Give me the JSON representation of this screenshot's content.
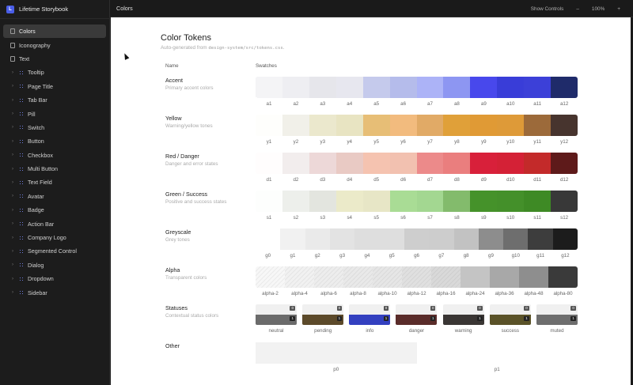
{
  "app": {
    "title": "Lifetime Storybook",
    "logo_letter": "L"
  },
  "sidebar": {
    "items": [
      {
        "label": "Colors",
        "kind": "doc",
        "active": true,
        "expandable": false
      },
      {
        "label": "Iconography",
        "kind": "doc",
        "active": false,
        "expandable": false
      },
      {
        "label": "Text",
        "kind": "doc",
        "active": false,
        "expandable": false
      },
      {
        "label": "Tooltip",
        "kind": "component",
        "active": false,
        "expandable": true
      },
      {
        "label": "Page Title",
        "kind": "component",
        "active": false,
        "expandable": true
      },
      {
        "label": "Tab Bar",
        "kind": "component",
        "active": false,
        "expandable": true
      },
      {
        "label": "Pill",
        "kind": "component",
        "active": false,
        "expandable": true
      },
      {
        "label": "Switch",
        "kind": "component",
        "active": false,
        "expandable": true
      },
      {
        "label": "Button",
        "kind": "component",
        "active": false,
        "expandable": true
      },
      {
        "label": "Checkbox",
        "kind": "component",
        "active": false,
        "expandable": true
      },
      {
        "label": "Multi Button",
        "kind": "component",
        "active": false,
        "expandable": true
      },
      {
        "label": "Text Field",
        "kind": "component",
        "active": false,
        "expandable": true
      },
      {
        "label": "Avatar",
        "kind": "component",
        "active": false,
        "expandable": true
      },
      {
        "label": "Badge",
        "kind": "component",
        "active": false,
        "expandable": true
      },
      {
        "label": "Action Bar",
        "kind": "component",
        "active": false,
        "expandable": true
      },
      {
        "label": "Company Logo",
        "kind": "component",
        "active": false,
        "expandable": true
      },
      {
        "label": "Segmented Control",
        "kind": "component",
        "active": false,
        "expandable": true
      },
      {
        "label": "Dialog",
        "kind": "component",
        "active": false,
        "expandable": true
      },
      {
        "label": "Dropdown",
        "kind": "component",
        "active": false,
        "expandable": true
      },
      {
        "label": "Sidebar",
        "kind": "component",
        "active": false,
        "expandable": true
      }
    ]
  },
  "topbar": {
    "title": "Colors",
    "show_controls": "Show Controls",
    "zoom_out": "–",
    "zoom_level": "100%",
    "zoom_in": "+"
  },
  "page": {
    "title": "Color Tokens",
    "subtitle_prefix": "Auto-generated from ",
    "subtitle_path": "design-system/src/tokens.css",
    "subtitle_suffix": ".",
    "col_name": "Name",
    "col_swatches": "Swatches"
  },
  "groups": [
    {
      "name": "Accent",
      "desc": "Primary accent colors",
      "swatches": [
        {
          "label": "a1",
          "color": "#fdfdff",
          "style": "dotted"
        },
        {
          "label": "a2",
          "color": "#f7f7fb",
          "style": "dotted"
        },
        {
          "label": "a3",
          "color": "#efeff4",
          "style": "dotted"
        },
        {
          "label": "a4",
          "color": "#e7e7ef",
          "style": "plain"
        },
        {
          "label": "a5",
          "color": "#cdd2f5",
          "style": "dotted"
        },
        {
          "label": "a6",
          "color": "#bcc3f4",
          "style": "dotted"
        },
        {
          "label": "a7",
          "color": "#acb3f7",
          "style": "plain"
        },
        {
          "label": "a8",
          "color": "#8d96f2",
          "style": "plain"
        },
        {
          "label": "a9",
          "color": "#4848ec",
          "style": "plain"
        },
        {
          "label": "a10",
          "color": "#3b3fe0",
          "style": "dotted"
        },
        {
          "label": "a11",
          "color": "#3c40d8",
          "style": "plain"
        },
        {
          "label": "a12",
          "color": "#1f2b6a",
          "style": "plain"
        }
      ]
    },
    {
      "name": "Yellow",
      "desc": "Warning/yellow tones",
      "swatches": [
        {
          "label": "y1",
          "color": "#fefefc",
          "style": "plain"
        },
        {
          "label": "y2",
          "color": "#faf9f2",
          "style": "dotted"
        },
        {
          "label": "y3",
          "color": "#ebe8cd",
          "style": "plain"
        },
        {
          "label": "y4",
          "color": "#e8e4c2",
          "style": "plain"
        },
        {
          "label": "y5",
          "color": "#f0c57a",
          "style": "dotted"
        },
        {
          "label": "y6",
          "color": "#f2bb7e",
          "style": "plain"
        },
        {
          "label": "y7",
          "color": "#eab06a",
          "style": "dotted"
        },
        {
          "label": "y8",
          "color": "#e0a039",
          "style": "plain"
        },
        {
          "label": "y9",
          "color": "#e09a35",
          "style": "plain"
        },
        {
          "label": "y10",
          "color": "#de9a38",
          "style": "plain"
        },
        {
          "label": "y11",
          "color": "#9c6a3a",
          "style": "plain"
        },
        {
          "label": "y12",
          "color": "#4a3630",
          "style": "dotted"
        }
      ]
    },
    {
      "name": "Red / Danger",
      "desc": "Danger and error states",
      "swatches": [
        {
          "label": "d1",
          "color": "#fffdfd",
          "style": "plain"
        },
        {
          "label": "d2",
          "color": "#fbf6f6",
          "style": "dotted"
        },
        {
          "label": "d3",
          "color": "#f6e0e0",
          "style": "dotted"
        },
        {
          "label": "d4",
          "color": "#f2d2cc",
          "style": "dotted"
        },
        {
          "label": "d5",
          "color": "#f5c3b0",
          "style": "plain"
        },
        {
          "label": "d6",
          "color": "#f2c1b0",
          "style": "plain"
        },
        {
          "label": "d7",
          "color": "#ec8a8a",
          "style": "plain"
        },
        {
          "label": "d8",
          "color": "#ea7e7e",
          "style": "plain"
        },
        {
          "label": "d9",
          "color": "#d8203a",
          "style": "plain"
        },
        {
          "label": "d10",
          "color": "#d42136",
          "style": "plain"
        },
        {
          "label": "d11",
          "color": "#c32a2a",
          "style": "plain"
        },
        {
          "label": "d12",
          "color": "#5e1a1a",
          "style": "plain"
        }
      ]
    },
    {
      "name": "Green / Success",
      "desc": "Positive and success states",
      "swatches": [
        {
          "label": "s1",
          "color": "#fdfefd",
          "style": "plain"
        },
        {
          "label": "s2",
          "color": "#f6f8f4",
          "style": "dotted"
        },
        {
          "label": "s3",
          "color": "#eceee8",
          "style": "dotted"
        },
        {
          "label": "s4",
          "color": "#ebeac9",
          "style": "plain"
        },
        {
          "label": "s5",
          "color": "#e7e6c6",
          "style": "plain"
        },
        {
          "label": "s6",
          "color": "#a9dc95",
          "style": "plain"
        },
        {
          "label": "s7",
          "color": "#a3d791",
          "style": "plain"
        },
        {
          "label": "s8",
          "color": "#83bb6c",
          "style": "plain"
        },
        {
          "label": "s9",
          "color": "#45922a",
          "style": "plain"
        },
        {
          "label": "s10",
          "color": "#44902a",
          "style": "plain"
        },
        {
          "label": "s11",
          "color": "#3e8a25",
          "style": "plain"
        },
        {
          "label": "s12",
          "color": "#383838",
          "style": "plain"
        }
      ]
    },
    {
      "name": "Greyscale",
      "desc": "Grey tones",
      "swatches": [
        {
          "label": "g0",
          "color": "#ffffff",
          "style": "plain"
        },
        {
          "label": "g1",
          "color": "#fafafa",
          "style": "dotted"
        },
        {
          "label": "g2",
          "color": "#f3f3f3",
          "style": "dotted"
        },
        {
          "label": "g3",
          "color": "#ececec",
          "style": "dotted"
        },
        {
          "label": "g4",
          "color": "#e6e6e6",
          "style": "dotted"
        },
        {
          "label": "g5",
          "color": "#dedede",
          "style": "plain"
        },
        {
          "label": "g6",
          "color": "#d6d6d6",
          "style": "dotted"
        },
        {
          "label": "g7",
          "color": "#cdcdcd",
          "style": "plain"
        },
        {
          "label": "g8",
          "color": "#c2c2c2",
          "style": "plain"
        },
        {
          "label": "g9",
          "color": "#8d8d8d",
          "style": "plain"
        },
        {
          "label": "g10",
          "color": "#6e6e6e",
          "style": "plain"
        },
        {
          "label": "g11",
          "color": "#3d3d3d",
          "style": "plain"
        },
        {
          "label": "g12",
          "color": "#1c1c1c",
          "style": "plain"
        }
      ]
    },
    {
      "name": "Alpha",
      "desc": "Transparent colors",
      "swatches": [
        {
          "label": "alpha-2",
          "color": "#f7f7f7",
          "style": "hatch"
        },
        {
          "label": "alpha-4",
          "color": "#f1f1f1",
          "style": "hatch"
        },
        {
          "label": "alpha-6",
          "color": "#ededed",
          "style": "hatch"
        },
        {
          "label": "alpha-8",
          "color": "#e9e9e9",
          "style": "hatch"
        },
        {
          "label": "alpha-10",
          "color": "#e6e6e6",
          "style": "hatch"
        },
        {
          "label": "alpha-12",
          "color": "#e0e0e0",
          "style": "hatch"
        },
        {
          "label": "alpha-16",
          "color": "#d9d9d9",
          "style": "hatch"
        },
        {
          "label": "alpha-24",
          "color": "#c4c4c4",
          "style": "plain"
        },
        {
          "label": "alpha-36",
          "color": "#a8a8a8",
          "style": "plain"
        },
        {
          "label": "alpha-48",
          "color": "#8e8e8e",
          "style": "plain"
        },
        {
          "label": "alpha-80",
          "color": "#3a3a3a",
          "style": "plain"
        }
      ]
    }
  ],
  "statuses": {
    "name": "Statuses",
    "desc": "Contextual status colors",
    "badge_top": "0",
    "badge_bottom": "1",
    "items": [
      {
        "label": "neutral",
        "color": "#6b6b6b"
      },
      {
        "label": "pending",
        "color": "#5c4a2a"
      },
      {
        "label": "info",
        "color": "#3340c0"
      },
      {
        "label": "danger",
        "color": "#5a2c2a"
      },
      {
        "label": "warning",
        "color": "#3a3634"
      },
      {
        "label": "success",
        "color": "#5a5228"
      },
      {
        "label": "muted",
        "color": "#6e6e6e"
      }
    ]
  },
  "other": {
    "name": "Other",
    "labels": [
      "p0",
      "p1"
    ]
  }
}
